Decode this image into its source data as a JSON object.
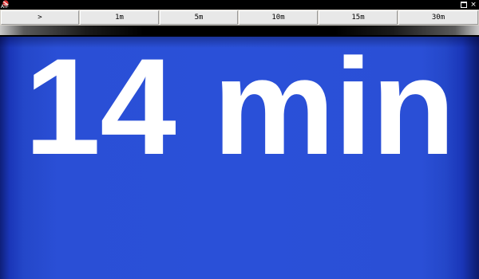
{
  "window": {
    "app_icon_label": "ATF",
    "maximize_icon": "maximize-icon",
    "close_icon": "close-icon",
    "close_glyph": "×"
  },
  "toolbar": {
    "buttons": [
      {
        "label": ">"
      },
      {
        "label": "1m"
      },
      {
        "label": "5m"
      },
      {
        "label": "10m"
      },
      {
        "label": "15m"
      },
      {
        "label": "30m"
      }
    ]
  },
  "display": {
    "countdown_text": "14 min"
  },
  "colors": {
    "display_background": "#2a50d8",
    "text": "#ffffff",
    "toolbar_background": "#d4d0c8"
  }
}
